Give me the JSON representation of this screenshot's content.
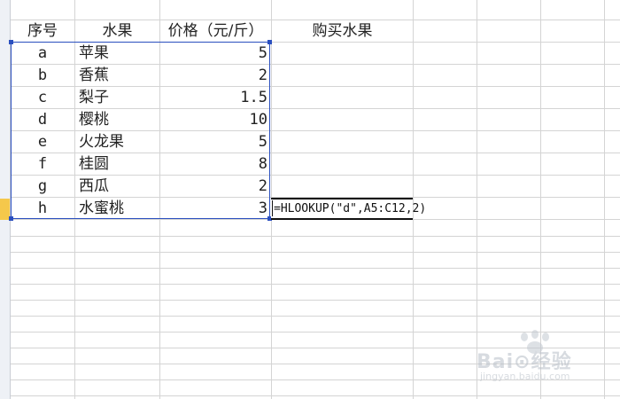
{
  "headers": {
    "col_a": "序号",
    "col_b": "水果",
    "col_c": "价格（元/斤）",
    "col_d": "购买水果"
  },
  "rows": [
    {
      "id": "a",
      "fruit": "苹果",
      "price": "5"
    },
    {
      "id": "b",
      "fruit": "香蕉",
      "price": "2"
    },
    {
      "id": "c",
      "fruit": "梨子",
      "price": "1.5"
    },
    {
      "id": "d",
      "fruit": "樱桃",
      "price": "10"
    },
    {
      "id": "e",
      "fruit": "火龙果",
      "price": "5"
    },
    {
      "id": "f",
      "fruit": "桂圆",
      "price": "8"
    },
    {
      "id": "g",
      "fruit": "西瓜",
      "price": "2"
    },
    {
      "id": "h",
      "fruit": "水蜜桃",
      "price": "3"
    }
  ],
  "formula_cell": {
    "value": "=HLOOKUP(\"d\",A5:C12,2)"
  },
  "watermark": {
    "brand": "Bai⊙经验",
    "url": "jingyan.baidu.com"
  },
  "colors": {
    "selection_border": "#2a4fbf",
    "active_row_header": "#f5c84b",
    "gridline": "#d4d4d4"
  }
}
